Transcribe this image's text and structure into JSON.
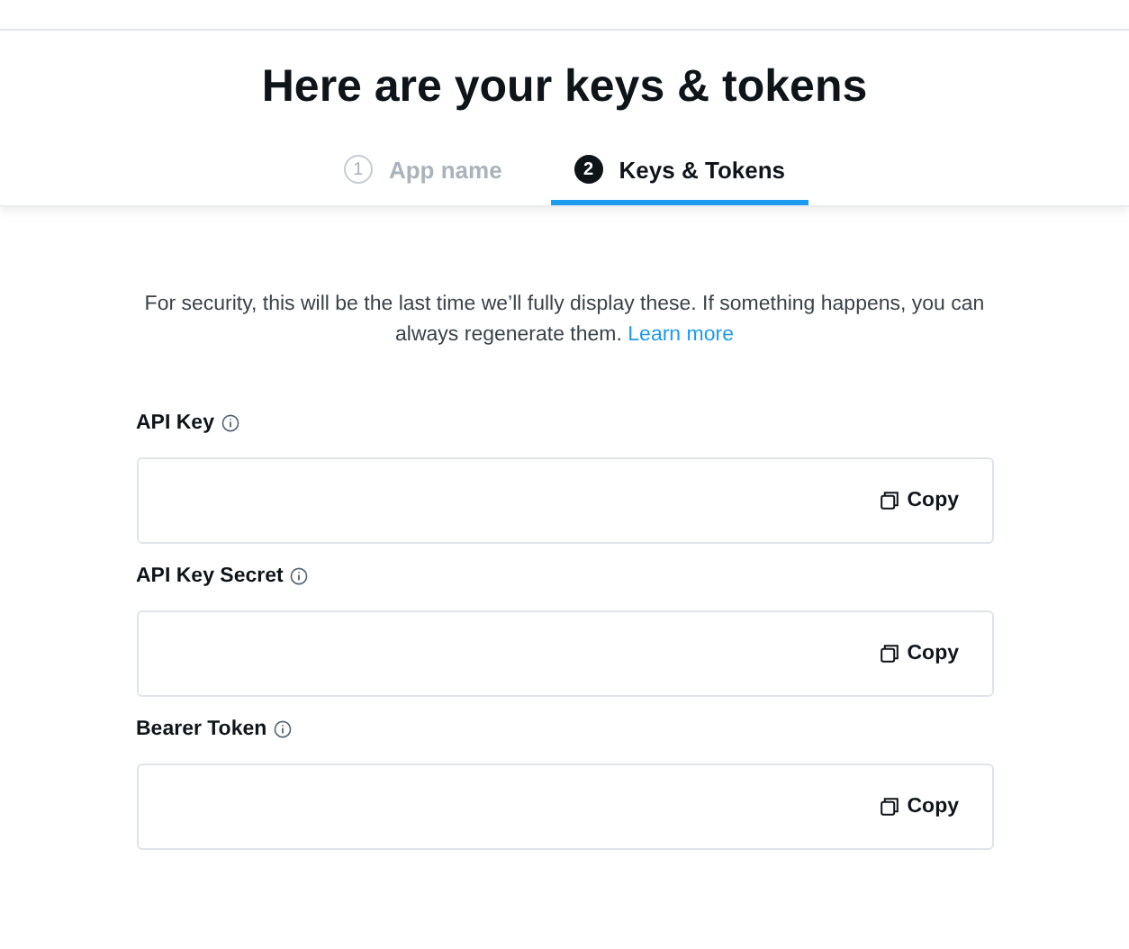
{
  "title": "Here are your keys & tokens",
  "steps": [
    {
      "number": "1",
      "label": "App name",
      "selected": false
    },
    {
      "number": "2",
      "label": "Keys & Tokens",
      "selected": true
    }
  ],
  "notice": {
    "text": "For security, this will be the last time we’ll fully display these. If something happens, you can always regenerate them.",
    "link": "Learn more"
  },
  "fields": [
    {
      "label": "API Key",
      "action": "Copy"
    },
    {
      "label": "API Key Secret",
      "action": "Copy"
    },
    {
      "label": "Bearer Token",
      "action": "Copy"
    }
  ]
}
